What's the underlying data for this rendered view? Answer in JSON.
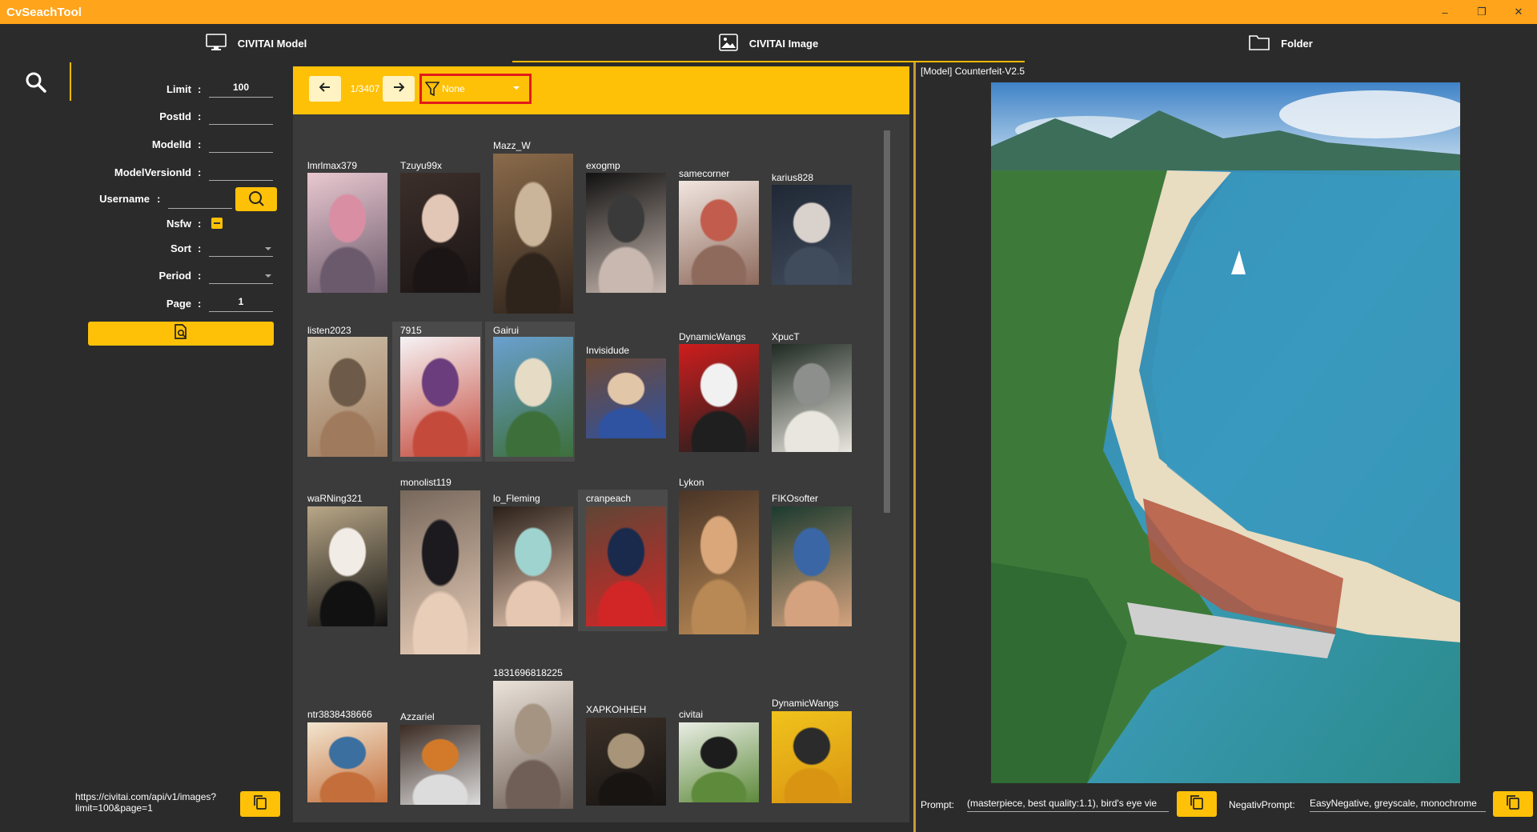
{
  "window": {
    "title": "CvSeachTool",
    "minimize": "–",
    "restore": "❐",
    "close": "✕"
  },
  "tabs": [
    {
      "label": "CIVITAI Model",
      "icon": "monitor-icon"
    },
    {
      "label": "CIVITAI Image",
      "icon": "image-icon",
      "active": true
    },
    {
      "label": "Folder",
      "icon": "folder-icon"
    }
  ],
  "form": {
    "limit_label": "Limit",
    "limit_value": "100",
    "postid_label": "PostId",
    "postid_value": "",
    "modelid_label": "ModelId",
    "modelid_value": "",
    "modelversionid_label": "ModelVersionId",
    "modelversionid_value": "",
    "username_label": "Username",
    "username_value": "",
    "nsfw_label": "Nsfw",
    "nsfw_state": "indeterminate",
    "sort_label": "Sort",
    "sort_value": "",
    "period_label": "Period",
    "period_value": "",
    "page_label": "Page",
    "page_value": "1",
    "colon": ":"
  },
  "api_url": {
    "line1": "https://civitai.com/api/v1/images?",
    "line2": "limit=100&page=1"
  },
  "pager": {
    "indicator": "1/3407",
    "prev_icon": "arrow-left-icon",
    "next_icon": "arrow-right-icon"
  },
  "filter": {
    "value": "None",
    "icon": "filter-icon"
  },
  "gallery": [
    {
      "user": "lmrlmax379",
      "colors": [
        "#e9c8d0",
        "#d98ea4",
        "#6b5a6b"
      ]
    },
    {
      "user": "Tzuyu99x",
      "colors": [
        "#3c2f2a",
        "#e3c7b6",
        "#1b1515"
      ]
    },
    {
      "user": "Mazz_W",
      "colors": [
        "#8a6a4a",
        "#cbb59a",
        "#2f241c"
      ]
    },
    {
      "user": "exogmp",
      "colors": [
        "#111111",
        "#3a3a3a",
        "#c8b8b0"
      ]
    },
    {
      "user": "samecorner",
      "colors": [
        "#f1e6e0",
        "#c25c4c",
        "#8e6a5c"
      ]
    },
    {
      "user": "karius828",
      "colors": [
        "#202835",
        "#d9d1cb",
        "#404b5c"
      ]
    },
    {
      "user": "listen2023",
      "colors": [
        "#cdbfa8",
        "#6e5a48",
        "#9f7a5d"
      ]
    },
    {
      "user": "7915",
      "colors": [
        "#f6f3f5",
        "#6b3d7c",
        "#c44a3c"
      ]
    },
    {
      "user": "Gairui",
      "colors": [
        "#6aa0cf",
        "#e6dcc5",
        "#3d6f3b"
      ]
    },
    {
      "user": "Invisidude",
      "colors": [
        "#6d4a35",
        "#e2c6a8",
        "#2f52a1"
      ]
    },
    {
      "user": "DynamicWangs",
      "colors": [
        "#cf1d1d",
        "#f1f1f1",
        "#1f1f1f"
      ]
    },
    {
      "user": "XpucT",
      "colors": [
        "#1f2a22",
        "#8d8f8c",
        "#e9e6df"
      ]
    },
    {
      "user": "waRNing321",
      "colors": [
        "#b9a787",
        "#f2ece6",
        "#111111"
      ]
    },
    {
      "user": "monolist119",
      "colors": [
        "#77685c",
        "#1c1a1f",
        "#e8cdb8"
      ]
    },
    {
      "user": "lo_Fleming",
      "colors": [
        "#2b2019",
        "#9fd3cf",
        "#e6c7b2"
      ]
    },
    {
      "user": "cranpeach",
      "colors": [
        "#5f4636",
        "#1a2a4d",
        "#d22626"
      ]
    },
    {
      "user": "Lykon",
      "colors": [
        "#4b3527",
        "#d9a77a",
        "#b88955"
      ]
    },
    {
      "user": "FIKOsofter",
      "colors": [
        "#1c3a2f",
        "#3a66a5",
        "#d4a27e"
      ]
    },
    {
      "user": "ntr3838438666",
      "colors": [
        "#f2e6d0",
        "#3a6fa0",
        "#c46e3b"
      ]
    },
    {
      "user": "Azzariel",
      "colors": [
        "#3b2b23",
        "#d37a2a",
        "#dcdcdc"
      ]
    },
    {
      "user": "1831696818225",
      "colors": [
        "#ebe3da",
        "#a59482",
        "#6f5f56"
      ]
    },
    {
      "user": "XAPKOHHEH",
      "colors": [
        "#3b3028",
        "#a89579",
        "#171412"
      ]
    },
    {
      "user": "civitai",
      "colors": [
        "#e9ede4",
        "#1c1c1c",
        "#5e8a3b"
      ]
    },
    {
      "user": "DynamicWangs",
      "colors": [
        "#f0c31c",
        "#2b2b2b",
        "#d99412"
      ]
    }
  ],
  "preview": {
    "model_tag": "[Model]",
    "model_name": "Counterfeit-V2.5"
  },
  "prompt": {
    "label": "Prompt:",
    "value": "(masterpiece, best quality:1.1), bird's eye vie"
  },
  "negative": {
    "label": "NegativPrompt:",
    "value": "EasyNegative, greyscale, monochrome"
  },
  "colors": {
    "accent": "#ffc107",
    "titlebar": "#ffa41b",
    "highlight_border": "#e21b1b"
  }
}
